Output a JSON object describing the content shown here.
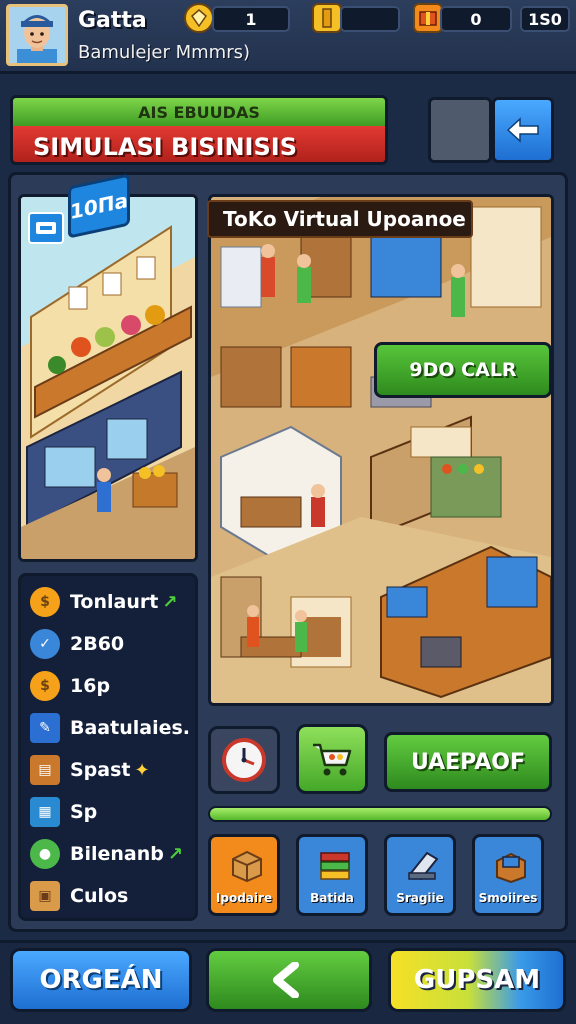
{
  "player": {
    "name": "Gatta",
    "subtitle": "Bamulejer Mmmrs)",
    "avatar_icon": "player-avatar"
  },
  "resources": {
    "gem_icon": "diamond-gem-icon",
    "gems": "1",
    "coin_icon": "gold-coin-icon",
    "cash_icon": "cash-chest-icon",
    "cash": "0",
    "level": "1S0"
  },
  "banner": {
    "kicker": "AIS EBUUDAS",
    "title": "SIMULASI BISINISIS"
  },
  "left_scene": {
    "badge": "10Па",
    "chip_icon": "ticket-icon"
  },
  "right_scene": {
    "title": "ToKo Virtual Upoanoe",
    "price_button": "9DO CALR"
  },
  "stats": [
    {
      "label": "Tonlaurt",
      "icon": "coin-icon",
      "trend": "up"
    },
    {
      "label": "2B60",
      "icon": "compass-icon"
    },
    {
      "label": "16p",
      "icon": "coin-icon"
    },
    {
      "label": "Baatulaies.",
      "icon": "edit-icon"
    },
    {
      "label": "Spast",
      "icon": "crate-icon",
      "spark": "sparkle"
    },
    {
      "label": "Sp",
      "icon": "basket-icon"
    },
    {
      "label": "Bilenanb",
      "icon": "green-orb-icon",
      "trend": "up"
    },
    {
      "label": "Culos",
      "icon": "box-icon"
    }
  ],
  "actions": {
    "clock_icon": "clock-icon",
    "cart_icon": "shopping-cart-icon",
    "upgrade_label": "UAEPAOF",
    "progress": 1.0
  },
  "tabs": [
    {
      "label": "Ipodaire",
      "icon": "parcel-icon",
      "color": "#f28a1c"
    },
    {
      "label": "Batida",
      "icon": "books-icon",
      "color": "#3a86d8"
    },
    {
      "label": "Sragiie",
      "icon": "scanner-icon",
      "color": "#3a86d8"
    },
    {
      "label": "Smoiires",
      "icon": "crates-icon",
      "color": "#3a86d8"
    }
  ],
  "bottom": {
    "left_label": "ORGEÁN",
    "center_icon": "back-arrow-icon",
    "right_label": "GUPSAM"
  },
  "colors": {
    "bg": "#1c2b45",
    "green": "#3f9c24",
    "red": "#e23a32",
    "blue": "#1e6fd1",
    "gold": "#f5c026",
    "orange": "#f28a1c"
  }
}
